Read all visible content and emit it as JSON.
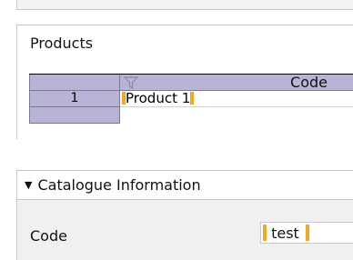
{
  "products": {
    "title": "Products",
    "grid": {
      "column_header": "Code",
      "rows": [
        {
          "number": "1",
          "code": "Product 1"
        },
        {
          "number": "",
          "code": ""
        }
      ]
    }
  },
  "catalogue": {
    "section_title": "Catalogue Information",
    "expanded": true,
    "fields": [
      {
        "label": "Code",
        "value": "test"
      }
    ]
  },
  "colors": {
    "grid_header_bg": "#b7b4d6",
    "edit_marker": "#f5a623",
    "panel_body_bg": "#f0f0f0"
  }
}
